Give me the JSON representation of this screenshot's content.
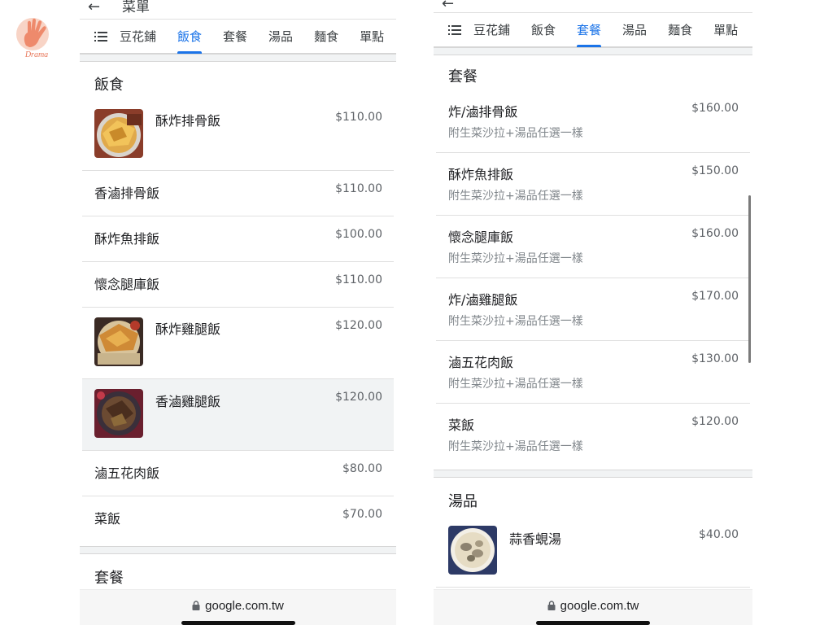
{
  "watermark": {
    "text": "Drama"
  },
  "left_panel": {
    "heading": "菜單",
    "tabs": [
      "豆花鋪",
      "飯食",
      "套餐",
      "湯品",
      "麵食",
      "單點"
    ],
    "active_tab": "飯食",
    "sections": [
      {
        "title": "飯食",
        "items": [
          {
            "name": "酥炸排骨飯",
            "price": "$110.00",
            "has_photo": true
          },
          {
            "name": "香滷排骨飯",
            "price": "$110.00"
          },
          {
            "name": "酥炸魚排飯",
            "price": "$100.00"
          },
          {
            "name": "懷念腿庫飯",
            "price": "$110.00"
          },
          {
            "name": "酥炸雞腿飯",
            "price": "$120.00",
            "has_photo": true
          },
          {
            "name": "香滷雞腿飯",
            "price": "$120.00",
            "has_photo": true,
            "highlighted": true
          },
          {
            "name": "滷五花肉飯",
            "price": "$80.00"
          },
          {
            "name": "菜飯",
            "price": "$70.00"
          }
        ]
      },
      {
        "title": "套餐"
      }
    ],
    "url": "google.com.tw"
  },
  "right_panel": {
    "tabs": [
      "豆花鋪",
      "飯食",
      "套餐",
      "湯品",
      "麵食",
      "單點"
    ],
    "active_tab": "套餐",
    "sections": [
      {
        "title": "套餐",
        "items": [
          {
            "name": "炸/滷排骨飯",
            "price": "$160.00",
            "desc": "附生菜沙拉+湯品任選一樣"
          },
          {
            "name": "酥炸魚排飯",
            "price": "$150.00",
            "desc": "附生菜沙拉+湯品任選一樣"
          },
          {
            "name": "懷念腿庫飯",
            "price": "$160.00",
            "desc": "附生菜沙拉+湯品任選一樣"
          },
          {
            "name": "炸/滷雞腿飯",
            "price": "$170.00",
            "desc": "附生菜沙拉+湯品任選一樣"
          },
          {
            "name": "滷五花肉飯",
            "price": "$130.00",
            "desc": "附生菜沙拉+湯品任選一樣"
          },
          {
            "name": "菜飯",
            "price": "$120.00",
            "desc": "附生菜沙拉+湯品任選一樣"
          }
        ]
      },
      {
        "title": "湯品",
        "items": [
          {
            "name": "蒜香蜆湯",
            "price": "$40.00",
            "has_photo": true
          }
        ]
      }
    ],
    "url": "google.com.tw"
  },
  "colors": {
    "accent": "#1a73e8",
    "text": "#202124",
    "muted": "#5f6368",
    "divider": "#e0e0e0",
    "section_gap": "#f1f3f4"
  }
}
